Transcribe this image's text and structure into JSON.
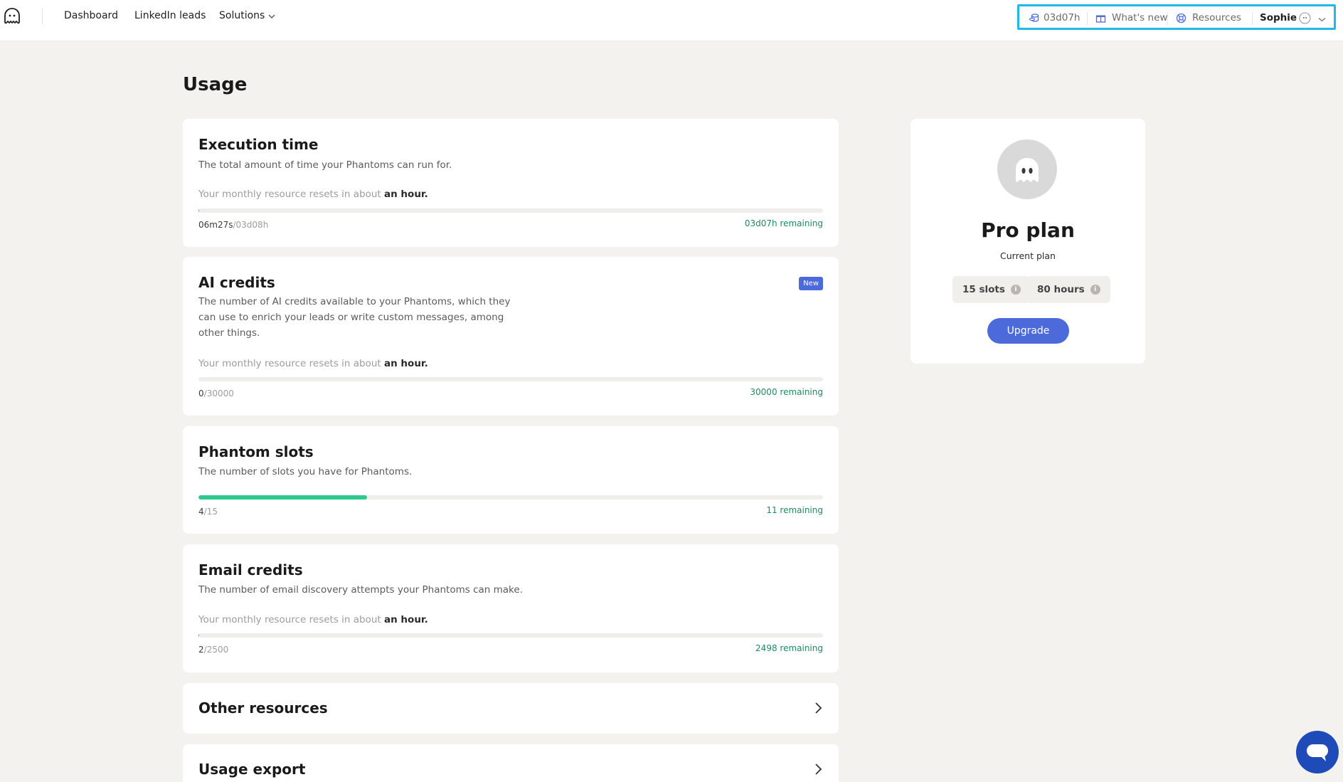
{
  "nav": {
    "logo_icon": "phantom-ghost-icon",
    "dashboard": "Dashboard",
    "linkedin_leads": "LinkedIn leads",
    "solutions": "Solutions"
  },
  "topright": {
    "time": "03d07h",
    "whats_new": "What's new",
    "resources": "Resources",
    "user": "Sophie"
  },
  "page": {
    "title": "Usage"
  },
  "execution": {
    "title": "Execution time",
    "desc": "The total amount of time your Phantoms can run for.",
    "reset_prefix": "Your monthly resource resets in about",
    "reset_bold": "an hour.",
    "used": "06m27s",
    "total": "03d08h",
    "remaining": "03d07h remaining",
    "progress_fraction": 0.001
  },
  "ai": {
    "title": "AI credits",
    "badge": "New",
    "desc": "The number of AI credits available to your Phantoms, which they can use to enrich your leads or write custom messages, among other things.",
    "reset_prefix": "Your monthly resource resets in about",
    "reset_bold": "an hour.",
    "used": "0",
    "total": "30000",
    "remaining": "30000 remaining",
    "progress_fraction": 0
  },
  "slots": {
    "title": "Phantom slots",
    "desc": "The number of slots you have for Phantoms.",
    "used": "4",
    "total": "15",
    "remaining": "11 remaining",
    "progress_fraction": 0.27
  },
  "email": {
    "title": "Email credits",
    "desc": "The number of email discovery attempts your Phantoms can make.",
    "reset_prefix": "Your monthly resource resets in about",
    "reset_bold": "an hour.",
    "used": "2",
    "total": "2500",
    "remaining": "2498 remaining",
    "progress_fraction": 0.001
  },
  "other": {
    "title": "Other resources"
  },
  "export": {
    "title": "Usage export"
  },
  "plan": {
    "name": "Pro plan",
    "sub": "Current plan",
    "slots": "15 slots",
    "hours": "80 hours",
    "info_glyph": "i",
    "upgrade": "Upgrade"
  },
  "colors": {
    "accent": "#4c6ad9",
    "progress": "#2ec98e",
    "remaining_text": "#1f8a5e",
    "highlight_border": "#22b8e6"
  }
}
